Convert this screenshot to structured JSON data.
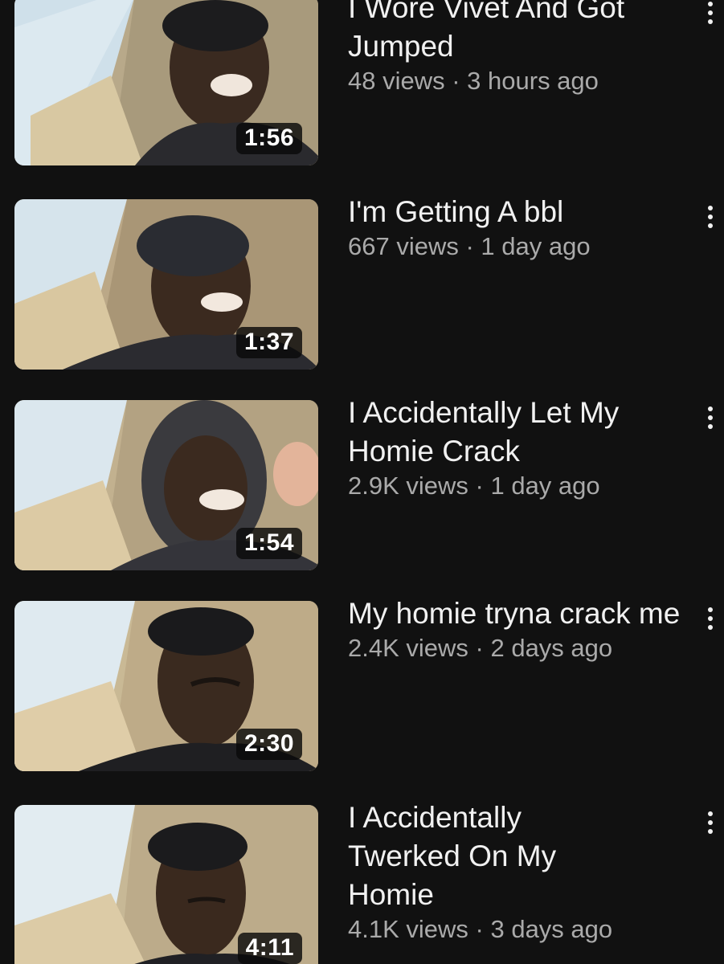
{
  "videos": [
    {
      "title": "I Wore Vivet And Got Jumped",
      "views": "48 views",
      "age": "3 hours ago",
      "duration": "1:56"
    },
    {
      "title": "I'm Getting A bbl",
      "views": "667 views",
      "age": "1 day ago",
      "duration": "1:37"
    },
    {
      "title": "I Accidentally Let My Homie Crack",
      "views": "2.9K views",
      "age": "1 day ago",
      "duration": "1:54"
    },
    {
      "title": "My homie tryna crack me",
      "views": "2.4K views",
      "age": "2 days ago",
      "duration": "2:30"
    },
    {
      "title": "I Accidentally Twerked On My Homie",
      "views": "4.1K views",
      "age": "3 days ago",
      "duration": "4:11"
    }
  ],
  "separator": " · ",
  "colors": {
    "background": "#111111",
    "title": "#f1f1f1",
    "meta": "#aaaaaa"
  },
  "icons": {
    "menu": "more-vert-icon"
  }
}
